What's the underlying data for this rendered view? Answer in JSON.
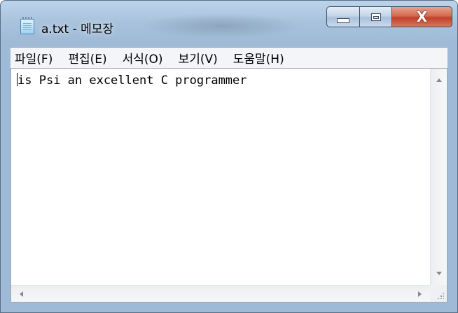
{
  "window": {
    "title": "a.txt - 메모장",
    "icon": "notepad-icon",
    "controls": {
      "minimize": "minimize-icon",
      "maximize": "maximize-icon",
      "close_glyph": "X",
      "close_color": "#c9462c"
    }
  },
  "menubar": {
    "items": [
      {
        "label": "파일(F)"
      },
      {
        "label": "편집(E)"
      },
      {
        "label": "서식(O)"
      },
      {
        "label": "보기(V)"
      },
      {
        "label": "도움말(H)"
      }
    ]
  },
  "editor": {
    "content": "is Psi an excellent C programmer"
  }
}
